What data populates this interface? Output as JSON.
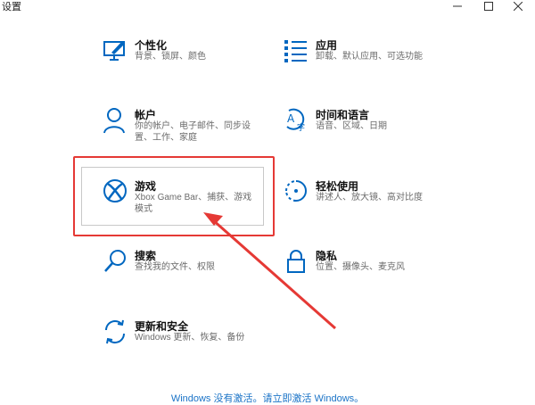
{
  "window": {
    "title": "设置",
    "controls": {
      "minimize": "minimize-icon",
      "maximize": "maximize-icon",
      "close": "close-icon"
    }
  },
  "accent_color": "#0067c0",
  "highlight_color": "#e53935",
  "categories": [
    {
      "id": "personalization",
      "name": "个性化",
      "lines": [
        "背景、锁屏、颜色"
      ],
      "icon": "paintbrush-monitor-icon"
    },
    {
      "id": "apps",
      "name": "应用",
      "lines": [
        "卸载、默认应用、可选功能"
      ],
      "icon": "app-list-icon"
    },
    {
      "id": "accounts",
      "name": "帐户",
      "lines": [
        "你的帐户、电子邮件、同步设",
        "置、工作、家庭"
      ],
      "icon": "person-icon"
    },
    {
      "id": "time-language",
      "name": "时间和语言",
      "lines": [
        "语音、区域、日期"
      ],
      "icon": "time-language-icon"
    },
    {
      "id": "gaming",
      "name": "游戏",
      "lines": [
        "Xbox Game Bar、捕获、游戏",
        "模式"
      ],
      "icon": "xbox-icon"
    },
    {
      "id": "ease-of-access",
      "name": "轻松使用",
      "lines": [
        "讲述人、放大镜、高对比度"
      ],
      "icon": "ease-of-access-icon"
    },
    {
      "id": "search",
      "name": "搜索",
      "lines": [
        "查找我的文件、权限"
      ],
      "icon": "search-icon"
    },
    {
      "id": "privacy",
      "name": "隐私",
      "lines": [
        "位置、摄像头、麦克风"
      ],
      "icon": "lock-icon"
    },
    {
      "id": "update-security",
      "name": "更新和安全",
      "lines": [
        "Windows 更新、恢复、备份"
      ],
      "icon": "sync-icon"
    }
  ],
  "activation_notice": "Windows 没有激活。请立即激活 Windows。"
}
